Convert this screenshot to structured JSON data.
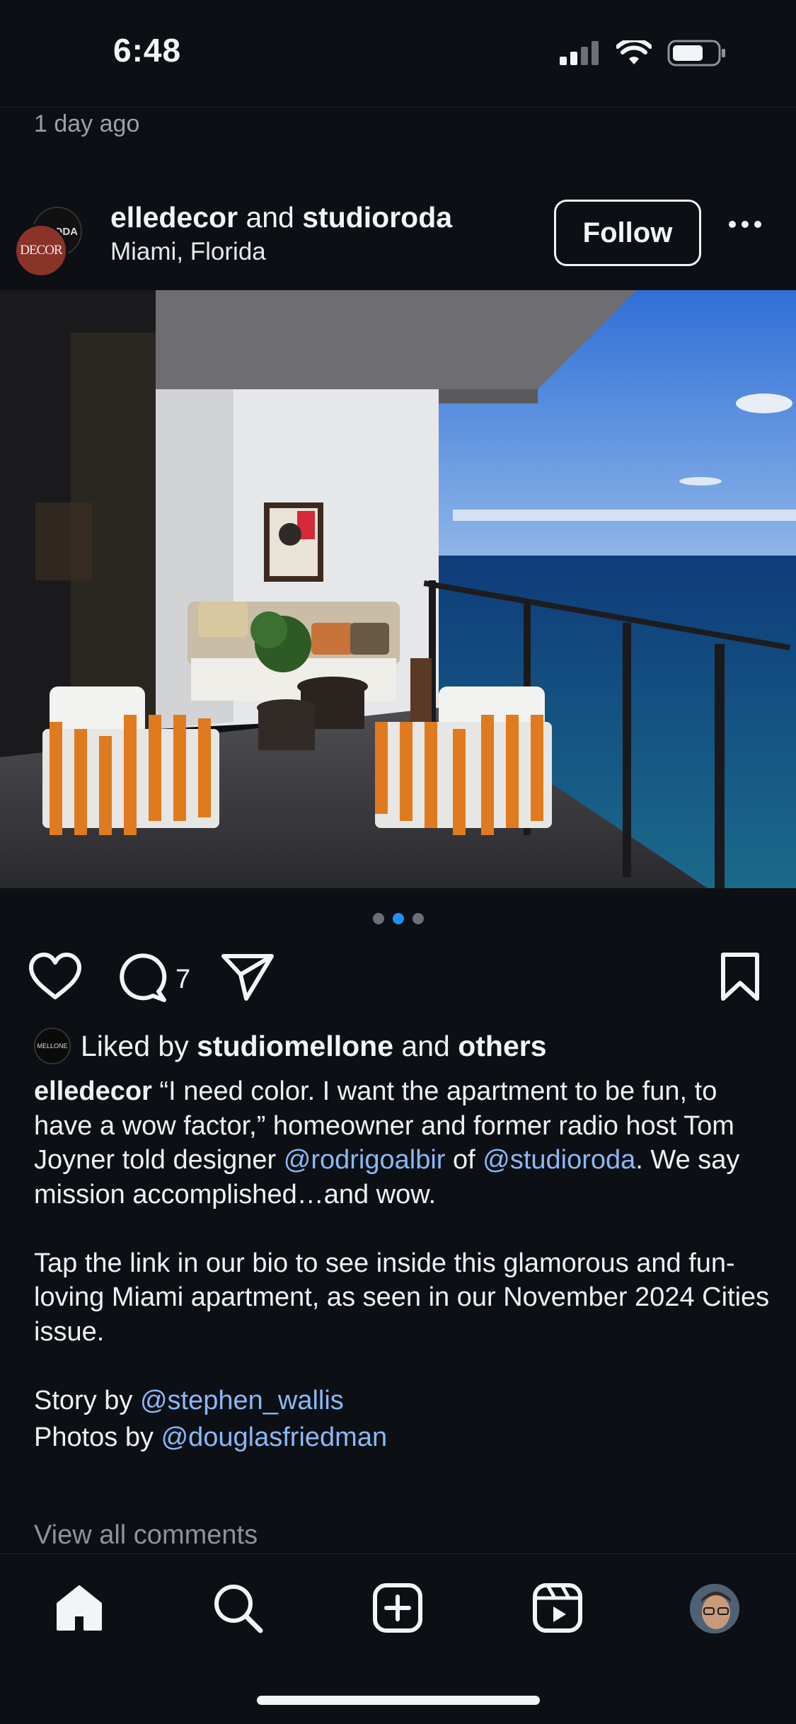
{
  "status": {
    "time": "6:48",
    "icons": [
      "cellular-signal-icon",
      "wifi-icon",
      "battery-icon"
    ]
  },
  "previous_post": {
    "timestamp": "1 day ago"
  },
  "post": {
    "author_primary": "elledecor",
    "author_joiner": " and ",
    "author_secondary": "studioroda",
    "location": "Miami, Florida",
    "follow_label": "Follow",
    "avatar_primary_text": "DECOR",
    "avatar_secondary_text": "RODA",
    "carousel": {
      "count": 3,
      "active_index": 1
    },
    "comment_count": "7",
    "liked_by_prefix": "Liked by ",
    "liked_by_user": "studiomellone",
    "liked_by_joiner": " and ",
    "liked_by_others": "others",
    "liked_avatar_text": "MELLONE",
    "caption": {
      "username": "elledecor",
      "text_1": " “I need color. I want the apartment to be fun, to have a wow factor,” homeowner and former radio host Tom Joyner told designer ",
      "mention_1": "@rodrigoalbir",
      "text_2": " of ",
      "mention_2": "@studioroda",
      "text_3": ". We say mission accomplished…and wow.",
      "paragraph_2": "Tap the link in our bio to see inside this glamorous and fun-loving Miami apartment, as seen in our November 2024 Cities issue.",
      "story_prefix": "Story by ",
      "story_mention": "@stephen_wallis",
      "photos_prefix": "Photos by ",
      "photos_mention": "@douglasfriedman"
    },
    "view_all_comments": "View all comments"
  },
  "tab_bar": {
    "items": [
      "home-icon",
      "search-icon",
      "create-icon",
      "reels-icon",
      "profile-avatar"
    ]
  },
  "colors": {
    "background": "#0c0f14",
    "text": "#f2f4f7",
    "mention": "#8ab8f5",
    "active_dot": "#1e90ff"
  }
}
